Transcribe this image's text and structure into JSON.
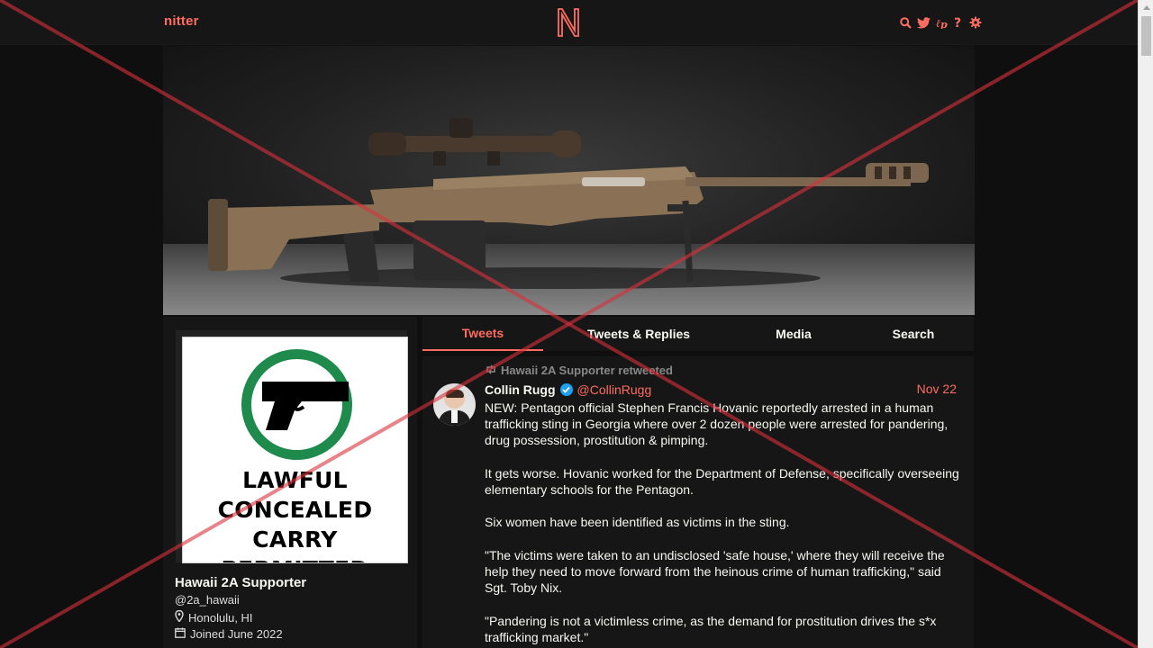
{
  "nav": {
    "brand": "nitter",
    "icons": [
      "search-icon",
      "twitter-bird-icon",
      "rss-icon",
      "help-icon",
      "settings-gear-icon"
    ],
    "accent_color": "#ff6c60"
  },
  "profile": {
    "name": "Hawaii 2A Supporter",
    "handle": "@2a_hawaii",
    "location": "Honolulu, HI",
    "joined": "Joined June 2022",
    "avatar_sign_lines": [
      "LAWFUL",
      "CONCEALED",
      "CARRY",
      "PERMITTED"
    ]
  },
  "tabs": [
    {
      "label": "Tweets",
      "active": true
    },
    {
      "label": "Tweets & Replies",
      "active": false
    },
    {
      "label": "Media",
      "active": false
    },
    {
      "label": "Search",
      "active": false
    }
  ],
  "tweet": {
    "retweet_note": "Hawaii 2A Supporter retweeted",
    "author_name": "Collin Rugg",
    "author_handle": "@CollinRugg",
    "verified": true,
    "date": "Nov 22",
    "paragraphs": [
      "NEW: Pentagon official Stephen Francis Hovanic reportedly arrested in a human trafficking sting in Georgia where over 2 dozen people were arrested for pandering, drug possession, prostitution & pimping.",
      "It gets worse. Hovanic worked for the Department of Defense, specifically overseeing elementary schools for the Pentagon.",
      "Six women have been identified as victims in the sting.",
      "\"The victims were taken to an undisclosed 'safe house,' where they will receive the help they need to move forward from the heinous crime of human trafficking,\" said Sgt. Toby Nix.",
      "\"Pandering is not a victimless crime, as the demand for prostitution drives the s*x trafficking market.\""
    ]
  }
}
